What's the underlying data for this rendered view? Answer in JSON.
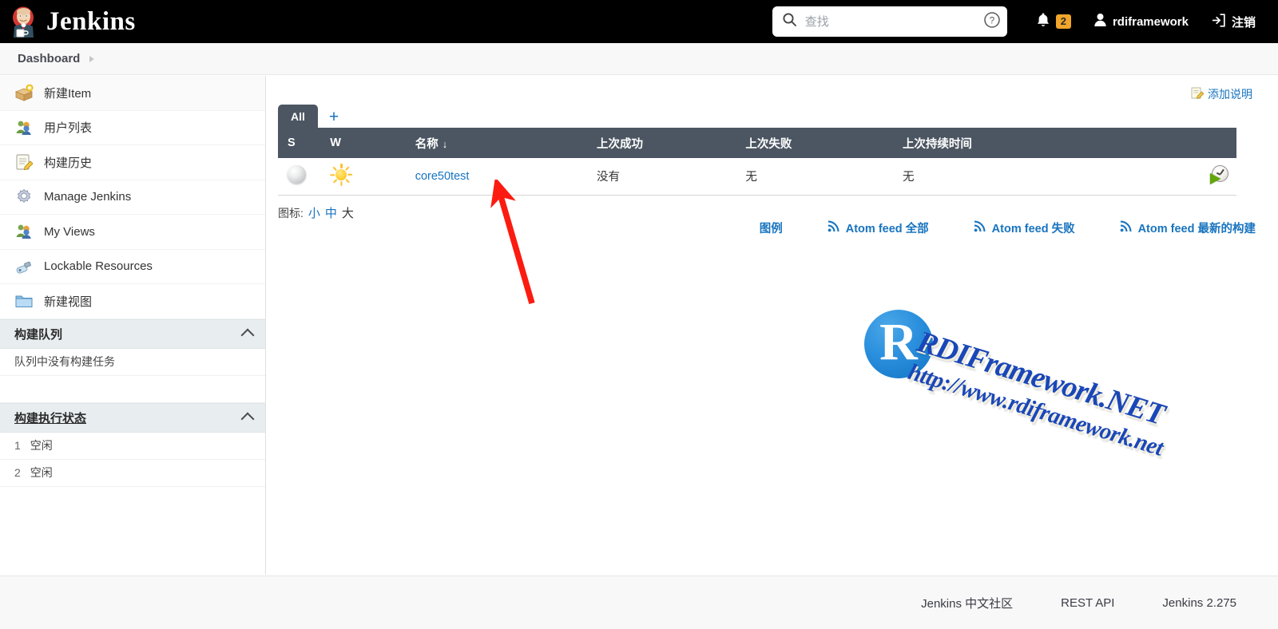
{
  "header": {
    "brand": "Jenkins",
    "brand_icon": "jenkins-butler-icon",
    "search": {
      "value": "",
      "placeholder": "查找",
      "icon": "search-icon",
      "help_icon": "help-circle-icon"
    },
    "notifications": {
      "icon": "bell-icon",
      "count": "2"
    },
    "user": {
      "icon": "person-icon",
      "name": "rdiframework"
    },
    "logout": {
      "icon": "logout-icon",
      "label": "注销"
    }
  },
  "breadcrumb": {
    "items": [
      "Dashboard"
    ],
    "caret_icon": "chevron-right-icon"
  },
  "sidebar": {
    "items": [
      {
        "label": "新建Item",
        "icon": "new-item-icon"
      },
      {
        "label": "用户列表",
        "icon": "people-icon"
      },
      {
        "label": "构建历史",
        "icon": "notepad-icon"
      },
      {
        "label": "Manage Jenkins",
        "icon": "gear-icon"
      },
      {
        "label": "My Views",
        "icon": "people-icon"
      },
      {
        "label": "Lockable Resources",
        "icon": "usb-lock-icon"
      },
      {
        "label": "新建视图",
        "icon": "folder-icon"
      }
    ],
    "build_queue": {
      "title": "构建队列",
      "empty_text": "队列中没有构建任务",
      "collapse_icon": "chevron-up-icon"
    },
    "build_executor": {
      "title": "构建执行状态",
      "collapse_icon": "chevron-up-icon",
      "executors": [
        {
          "num": "1",
          "status": "空闲"
        },
        {
          "num": "2",
          "status": "空闲"
        }
      ]
    }
  },
  "main": {
    "add_description": {
      "label": "添加说明",
      "icon": "edit-note-icon"
    },
    "tabs": [
      {
        "label": "All",
        "active": true
      }
    ],
    "add_tab": {
      "label": "+",
      "icon": "plus-icon"
    },
    "table": {
      "columns": [
        {
          "key": "s",
          "label": "S"
        },
        {
          "key": "w",
          "label": "W"
        },
        {
          "key": "name",
          "label": "名称",
          "sort_indicator": "↓"
        },
        {
          "key": "last_success",
          "label": "上次成功"
        },
        {
          "key": "last_failure",
          "label": "上次失败"
        },
        {
          "key": "last_duration",
          "label": "上次持续时间"
        },
        {
          "key": "actions",
          "label": ""
        }
      ],
      "rows": [
        {
          "s_icon": "status-ball-grey-icon",
          "w_icon": "weather-sunny-icon",
          "name": "core50test",
          "last_success": "没有",
          "last_failure": "无",
          "last_duration": "无",
          "action_icon": "schedule-build-icon"
        }
      ]
    },
    "icon_size": {
      "label": "图标:",
      "options": [
        {
          "label": "小",
          "active": false
        },
        {
          "label": "中",
          "active": false
        },
        {
          "label": "大",
          "active": true
        }
      ]
    },
    "legend_link": "图例",
    "feeds": [
      {
        "label": "Atom feed 全部",
        "icon": "rss-icon"
      },
      {
        "label": "Atom feed 失败",
        "icon": "rss-icon"
      },
      {
        "label": "Atom feed 最新的构建",
        "icon": "rss-icon"
      }
    ]
  },
  "watermark": {
    "badge_letter": "R",
    "line1": "RDIFramework.NET",
    "line2": "http://www.rdiframework.net"
  },
  "annotation": {
    "arrow_color": "#fc1b10",
    "points_to": "core50test"
  },
  "footer": {
    "links": [
      {
        "label": "Jenkins 中文社区"
      },
      {
        "label": "REST API"
      },
      {
        "label": "Jenkins 2.275"
      }
    ]
  },
  "colors": {
    "header_bg": "#000000",
    "table_header_bg": "#4c5662",
    "link_blue": "#1874bf",
    "badge_orange": "#f0a52b",
    "arrow_red": "#fc1b10"
  }
}
